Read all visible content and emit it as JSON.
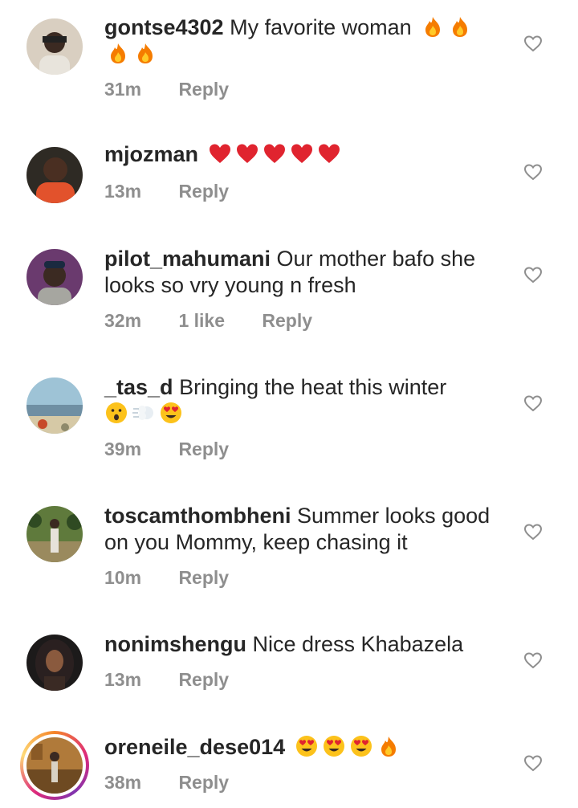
{
  "comments": [
    {
      "username": "gontse4302",
      "text": "My favorite woman",
      "emojis": [
        "fire",
        "fire",
        "fire",
        "fire"
      ],
      "time": "31m",
      "likes": "",
      "reply": "Reply"
    },
    {
      "username": "mjozman",
      "text": "",
      "emojis": [
        "red-heart",
        "red-heart",
        "red-heart",
        "red-heart",
        "red-heart"
      ],
      "time": "13m",
      "likes": "",
      "reply": "Reply"
    },
    {
      "username": "pilot_mahumani",
      "text": "Our mother bafo she looks so vry young n fresh",
      "emojis": [],
      "time": "32m",
      "likes": "1 like",
      "reply": "Reply"
    },
    {
      "username": "_tas_d",
      "text": "Bringing the heat this winter",
      "emojis": [
        "astonished-face",
        "dashing-away",
        "heart-eyes"
      ],
      "time": "39m",
      "likes": "",
      "reply": "Reply"
    },
    {
      "username": "toscamthombheni",
      "text": "Summer looks good on you Mommy, keep chasing it",
      "emojis": [],
      "time": "10m",
      "likes": "",
      "reply": "Reply"
    },
    {
      "username": "nonimshengu",
      "text": "Nice dress Khabazela",
      "emojis": [],
      "time": "13m",
      "likes": "",
      "reply": "Reply"
    },
    {
      "username": "oreneile_dese014",
      "text": "",
      "emojis": [
        "heart-eyes",
        "heart-eyes",
        "heart-eyes",
        "fire"
      ],
      "time": "38m",
      "likes": "",
      "reply": "Reply"
    }
  ],
  "icons": {
    "like": "heart-outline-icon"
  },
  "colors": {
    "text": "#262626",
    "meta": "#8e8e8e",
    "heart": "#8e8e8e",
    "story_ring_start": "#f58529",
    "story_ring_end": "#dd2a7b"
  }
}
